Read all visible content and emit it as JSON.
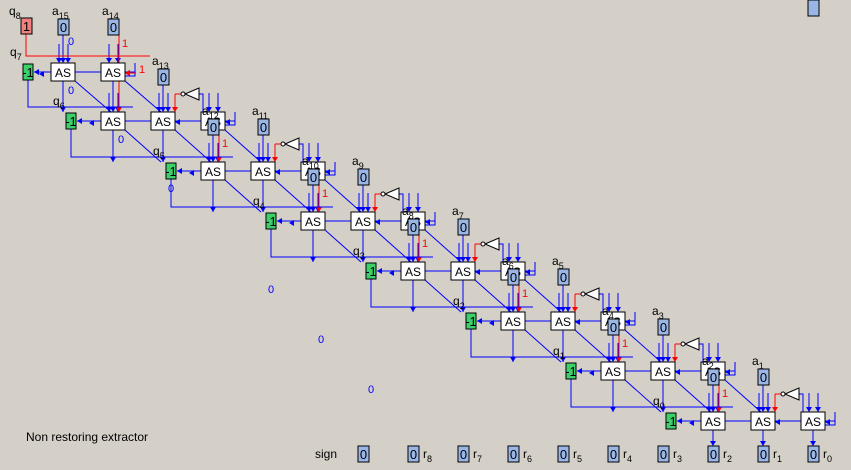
{
  "title": "Non restoring extractor",
  "colors": {
    "background": "#d4d0c8",
    "wire": "#0000ff",
    "control_wire": "#ff0000",
    "cell_fill": "#ffffff",
    "input_fill": "#9ab6e6",
    "q_fill": "#3ccf6a",
    "q8_fill": "#f08080"
  },
  "cell_label": "AS",
  "a_inputs": [
    {
      "sub": "15",
      "value": "0"
    },
    {
      "sub": "14",
      "value": "0"
    },
    {
      "sub": "13",
      "value": "0"
    },
    {
      "sub": "12",
      "value": "0"
    },
    {
      "sub": "11",
      "value": "0"
    },
    {
      "sub": "10",
      "value": "0"
    },
    {
      "sub": "9",
      "value": "0"
    },
    {
      "sub": "8",
      "value": "0"
    },
    {
      "sub": "7",
      "value": "0"
    },
    {
      "sub": "6",
      "value": "0"
    },
    {
      "sub": "5",
      "value": "0"
    },
    {
      "sub": "4",
      "value": "0"
    },
    {
      "sub": "3",
      "value": "0"
    },
    {
      "sub": "2",
      "value": "0"
    },
    {
      "sub": "1",
      "value": "0"
    },
    {
      "sub": "0",
      "value": "0"
    }
  ],
  "q8": {
    "sub": "8",
    "value": "1"
  },
  "q_outputs": [
    {
      "sub": "7",
      "value": "-1"
    },
    {
      "sub": "6",
      "value": "-1"
    },
    {
      "sub": "5",
      "value": "-1"
    },
    {
      "sub": "4",
      "value": "-1"
    },
    {
      "sub": "3",
      "value": "-1"
    },
    {
      "sub": "2",
      "value": "-1"
    },
    {
      "sub": "1",
      "value": "-1"
    },
    {
      "sub": "0",
      "value": "-1"
    }
  ],
  "r_outputs": [
    {
      "label": "sign",
      "value": "0"
    },
    {
      "label": "r",
      "sub": "8",
      "value": "0"
    },
    {
      "label": "r",
      "sub": "7",
      "value": "0"
    },
    {
      "label": "r",
      "sub": "6",
      "value": "0"
    },
    {
      "label": "r",
      "sub": "5",
      "value": "0"
    },
    {
      "label": "r",
      "sub": "4",
      "value": "0"
    },
    {
      "label": "r",
      "sub": "3",
      "value": "0"
    },
    {
      "label": "r",
      "sub": "2",
      "value": "0"
    },
    {
      "label": "r",
      "sub": "1",
      "value": "0"
    },
    {
      "label": "r",
      "sub": "0",
      "value": "0"
    }
  ],
  "wire_values": {
    "carry_in": "1",
    "zero": "0"
  }
}
